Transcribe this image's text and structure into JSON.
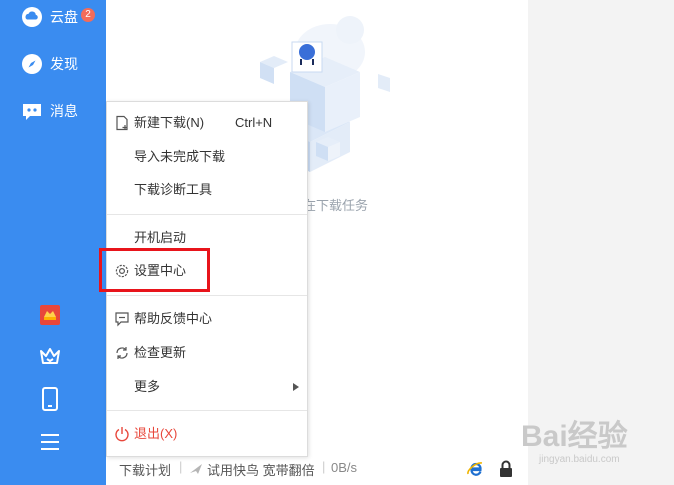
{
  "sidebar": {
    "items": [
      {
        "label": "云盘",
        "icon": "cloud-icon",
        "badge": "2"
      },
      {
        "label": "发现",
        "icon": "compass-icon"
      },
      {
        "label": "消息",
        "icon": "chat-icon"
      }
    ],
    "bottom_icons": [
      "red-gift-icon",
      "crown-icon",
      "phone-icon",
      "menu-icon"
    ]
  },
  "main": {
    "empty_text": "在下载任务"
  },
  "menu": {
    "items": [
      {
        "label": "新建下载(N)",
        "shortcut": "Ctrl+N",
        "icon": "new-file-icon"
      },
      {
        "label": "导入未完成下载"
      },
      {
        "label": "下载诊断工具"
      },
      {
        "label": "开机启动"
      },
      {
        "label": "设置中心",
        "icon": "gear-icon"
      },
      {
        "label": "帮助反馈中心",
        "icon": "feedback-icon"
      },
      {
        "label": "检查更新",
        "icon": "refresh-icon"
      },
      {
        "label": "更多"
      },
      {
        "label": "退出(X)",
        "icon": "power-icon"
      }
    ]
  },
  "statusbar": {
    "plan": "下载计划",
    "trial": "试用快鸟 宽带翻倍",
    "speed": "0B/s"
  },
  "watermark": {
    "text": "Bai经验",
    "url": "jingyan.baidu.com"
  },
  "colors": {
    "sidebar": "#3a8cf0",
    "highlight": "#e8141b",
    "exit": "#e8473b"
  }
}
